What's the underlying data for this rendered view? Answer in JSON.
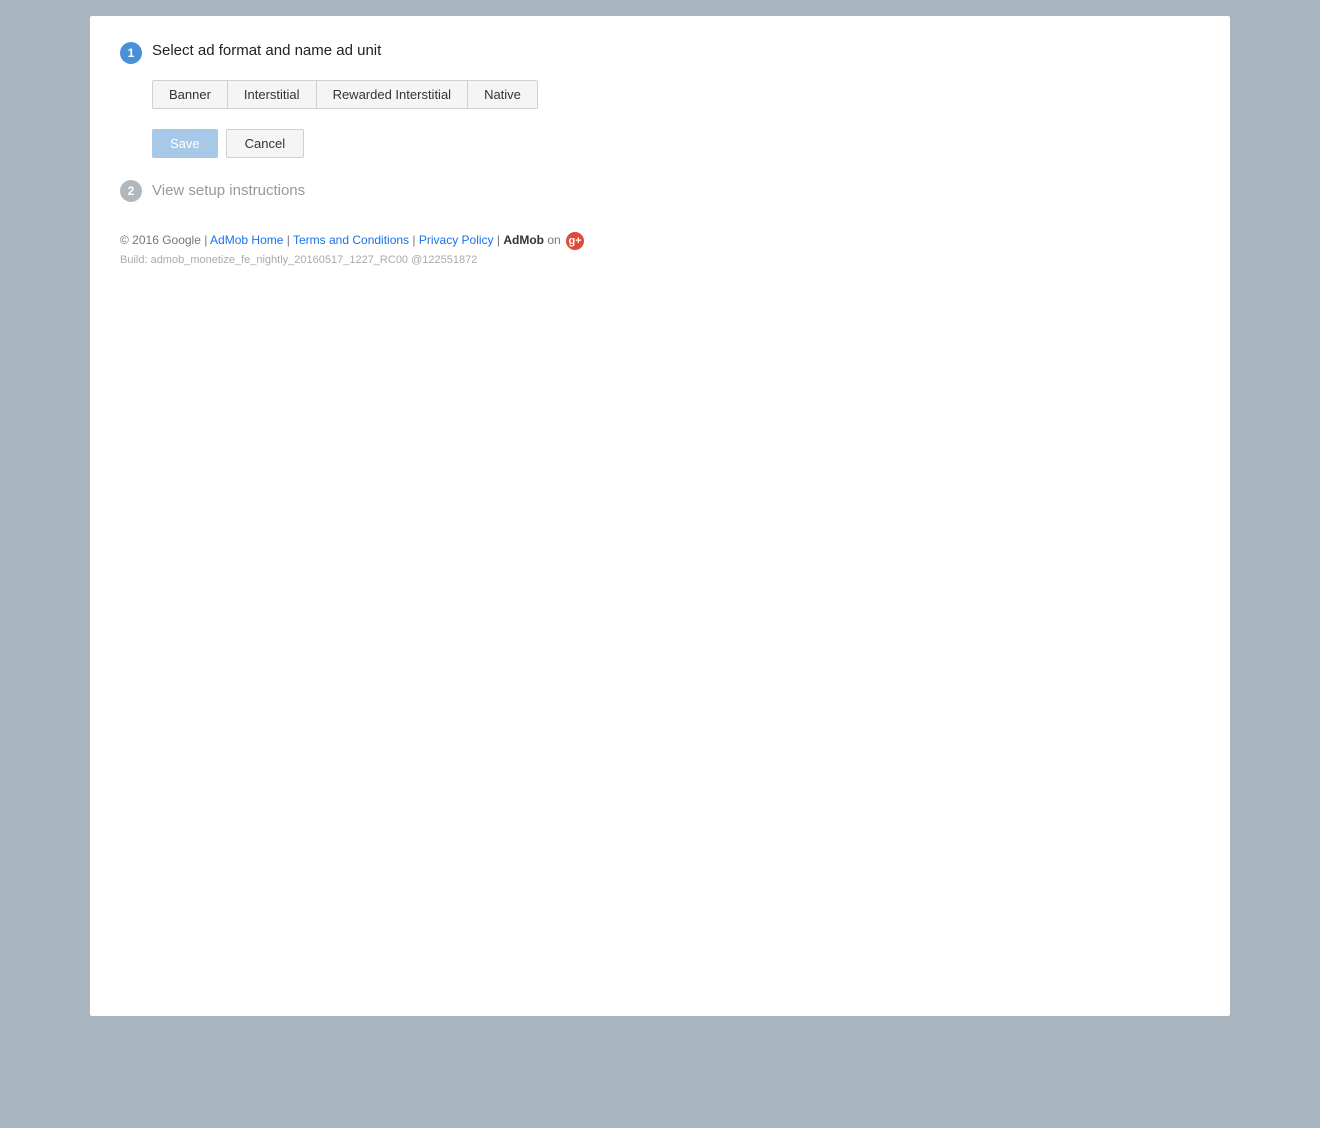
{
  "page": {
    "background": "#a8b5be"
  },
  "step1": {
    "badge": "1",
    "title": "Select ad format and name ad unit"
  },
  "step2": {
    "badge": "2",
    "title": "View setup instructions"
  },
  "tabs": [
    {
      "label": "Banner",
      "id": "banner"
    },
    {
      "label": "Interstitial",
      "id": "interstitial"
    },
    {
      "label": "Rewarded Interstitial",
      "id": "rewarded-interstitial"
    },
    {
      "label": "Native",
      "id": "native"
    }
  ],
  "buttons": {
    "save": "Save",
    "cancel": "Cancel"
  },
  "footer": {
    "copyright": "© 2016 Google",
    "separator": "|",
    "admob_home_label": "AdMob Home",
    "admob_home_url": "#",
    "terms_label": "Terms and Conditions",
    "terms_url": "#",
    "privacy_label": "Privacy Policy",
    "privacy_url": "#",
    "admob_label": "AdMob",
    "on_label": "on",
    "gplus_label": "g+",
    "build_label": "Build: admob_monetize_fe_nightly_20160517_1227_RC00 @122551872"
  }
}
